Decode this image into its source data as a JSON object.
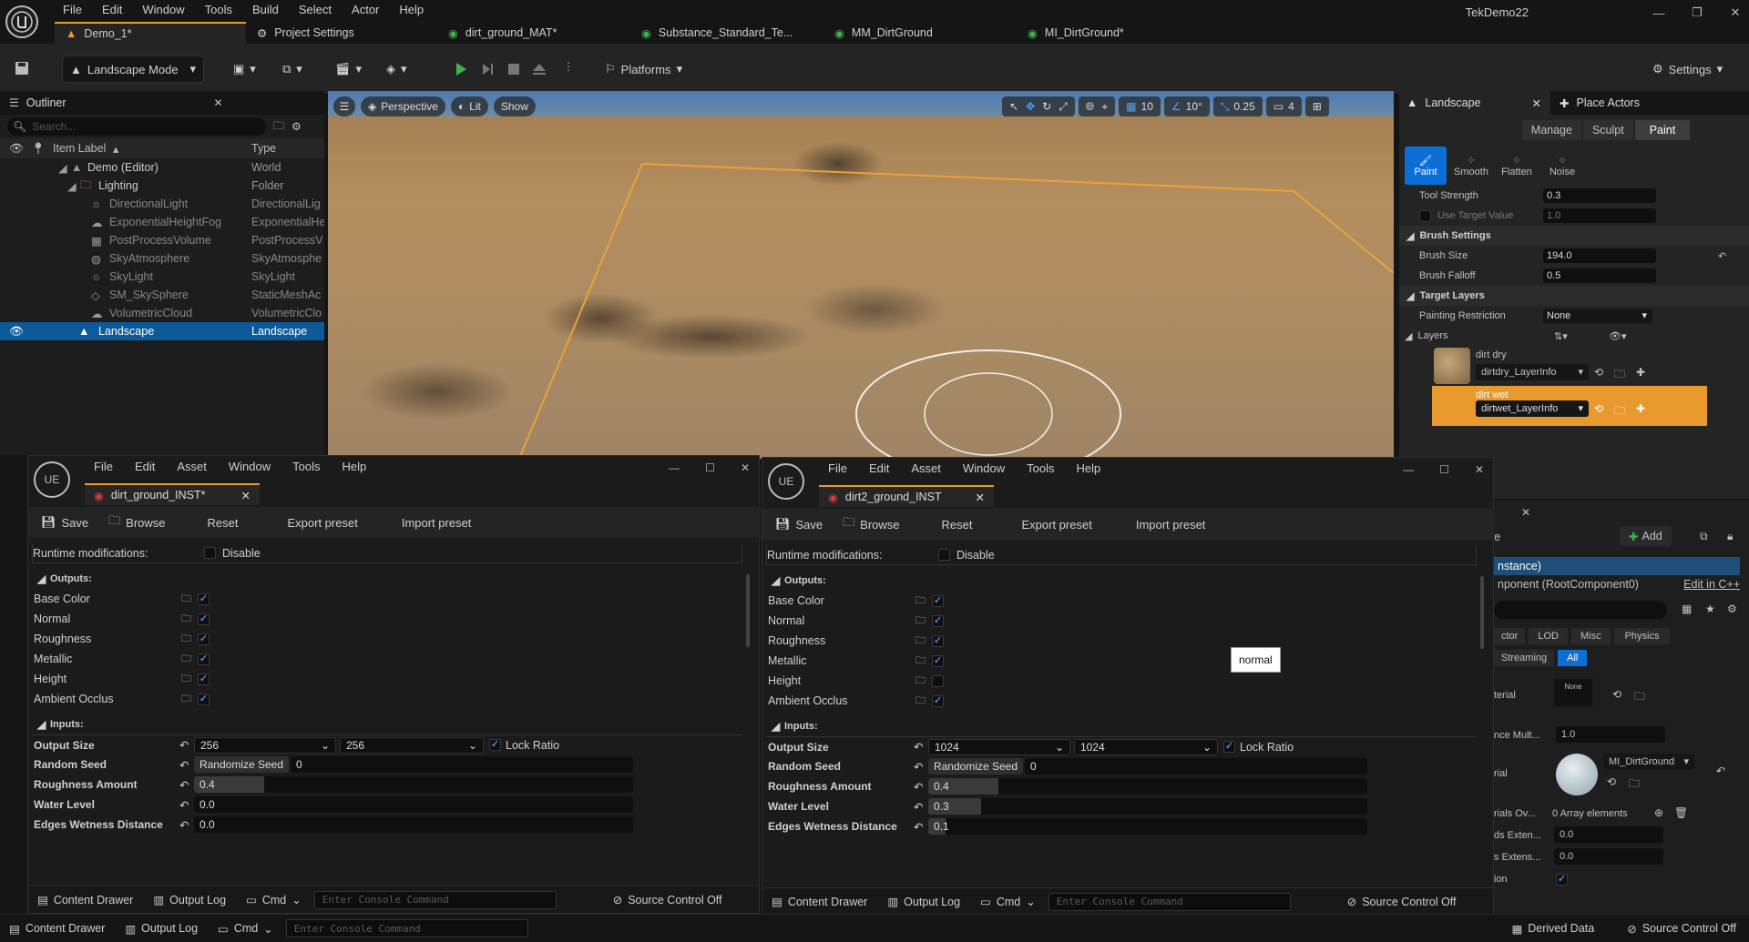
{
  "app": {
    "project_name": "TekDemo22",
    "menu": [
      "File",
      "Edit",
      "Window",
      "Tools",
      "Build",
      "Select",
      "Actor",
      "Help"
    ],
    "tabs": [
      {
        "label": "Demo_1*",
        "icon": "level-icon"
      },
      {
        "label": "Project Settings",
        "icon": "gear-icon"
      },
      {
        "label": "dirt_ground_MAT*",
        "icon": "substance-icon"
      },
      {
        "label": "Substance_Standard_Te...",
        "icon": "substance-icon"
      },
      {
        "label": "MM_DirtGround",
        "icon": "material-icon"
      },
      {
        "label": "MI_DirtGround*",
        "icon": "material-icon"
      }
    ]
  },
  "toolbar": {
    "mode_label": "Landscape Mode",
    "platforms_label": "Platforms",
    "settings_label": "Settings"
  },
  "outliner": {
    "tab_label": "Outliner",
    "search_placeholder": "Search...",
    "col_label": "Item Label",
    "col_type": "Type",
    "rows": [
      {
        "label": "Demo (Editor)",
        "type": "World",
        "indent": 0
      },
      {
        "label": "Lighting",
        "type": "Folder",
        "indent": 1
      },
      {
        "label": "DirectionalLight",
        "type": "DirectionalLig",
        "indent": 2
      },
      {
        "label": "ExponentialHeightFog",
        "type": "ExponentialHe",
        "indent": 2
      },
      {
        "label": "PostProcessVolume",
        "type": "PostProcessV",
        "indent": 2
      },
      {
        "label": "SkyAtmosphere",
        "type": "SkyAtmosphe",
        "indent": 2
      },
      {
        "label": "SkyLight",
        "type": "SkyLight",
        "indent": 2
      },
      {
        "label": "SM_SkySphere",
        "type": "StaticMeshAc",
        "indent": 2
      },
      {
        "label": "VolumetricCloud",
        "type": "VolumetricClo",
        "indent": 2
      },
      {
        "label": "Landscape",
        "type": "Landscape",
        "indent": 0
      }
    ]
  },
  "viewport": {
    "perspective": "Perspective",
    "lit": "Lit",
    "show": "Show",
    "grid_snap": "10",
    "rot_snap": "10°",
    "scale_snap": "0.25",
    "cam_speed": "4"
  },
  "landscape": {
    "tab_label": "Landscape",
    "place_tab_label": "Place Actors",
    "modes": [
      "Manage",
      "Sculpt",
      "Paint"
    ],
    "tools": [
      "Paint",
      "Smooth",
      "Flatten",
      "Noise"
    ],
    "tool_strength_label": "Tool Strength",
    "tool_strength": "0.3",
    "use_target_label": "Use Target Value",
    "use_target": "1.0",
    "brush_settings": "Brush Settings",
    "brush_size_label": "Brush Size",
    "brush_size": "194.0",
    "brush_falloff_label": "Brush Falloff",
    "brush_falloff": "0.5",
    "target_layers": "Target Layers",
    "painting_restriction_label": "Painting Restriction",
    "painting_restriction": "None",
    "layers_label": "Layers",
    "layer1_name": "dirt dry",
    "layer1_info": "dirtdry_LayerInfo",
    "layer2_name": "dirt wet",
    "layer2_info": "dirtwet_LayerInfo"
  },
  "details": {
    "add_label": "Add",
    "instance_label": "nstance)",
    "component_label": "nponent (RootComponent0)",
    "edit_cpp": "Edit in C++",
    "filters": [
      "ctor",
      "LOD",
      "Misc",
      "Physics"
    ],
    "filters2": [
      "Streaming",
      "All"
    ],
    "material_label": "terial",
    "material_none": "None",
    "tex_mult_label": "nce Mult...",
    "tex_mult": "1.0",
    "rial_label": "rial",
    "mi_name": "MI_DirtGround",
    "overrides_label": "rials Ov...",
    "overrides_value": "0 Array elements",
    "extent_label": "ds Exten...",
    "extent": "0.0",
    "extent2_label": "s Extens...",
    "extent2": "0.0",
    "ion_label": "ion"
  },
  "win1": {
    "menu": [
      "File",
      "Edit",
      "Asset",
      "Window",
      "Tools",
      "Help"
    ],
    "tab": "dirt_ground_INST*",
    "save": "Save",
    "browse": "Browse",
    "reset": "Reset",
    "export": "Export preset",
    "import": "Import preset",
    "runtime_label": "Runtime modifications:",
    "disable": "Disable",
    "outputs_label": "Outputs:",
    "outputs": [
      {
        "name": "Base Color",
        "on": true
      },
      {
        "name": "Normal",
        "on": true
      },
      {
        "name": "Roughness",
        "on": true
      },
      {
        "name": "Metallic",
        "on": true
      },
      {
        "name": "Height",
        "on": true
      },
      {
        "name": "Ambient Occlus",
        "on": true
      }
    ],
    "inputs_label": "Inputs:",
    "output_size_label": "Output Size",
    "size_w": "256",
    "size_h": "256",
    "lock_ratio": "Lock Ratio",
    "random_seed_label": "Random Seed",
    "randomize": "Randomize Seed",
    "seed": "0",
    "roughness_label": "Roughness Amount",
    "roughness": "0.4",
    "roughness_fill": 0.4,
    "water_label": "Water Level",
    "water": "0.0",
    "water_fill": 0.0,
    "edges_label": "Edges Wetness Distance",
    "edges": "0.0",
    "edges_fill": 0.0,
    "content_drawer": "Content Drawer",
    "output_log": "Output Log",
    "cmd": "Cmd",
    "console_placeholder": "Enter Console Command",
    "source_control": "Source Control Off"
  },
  "win2": {
    "menu": [
      "File",
      "Edit",
      "Asset",
      "Window",
      "Tools",
      "Help"
    ],
    "tab": "dirt2_ground_INST",
    "save": "Save",
    "browse": "Browse",
    "reset": "Reset",
    "export": "Export preset",
    "import": "Import preset",
    "runtime_label": "Runtime modifications:",
    "disable": "Disable",
    "outputs_label": "Outputs:",
    "outputs": [
      {
        "name": "Base Color",
        "on": true
      },
      {
        "name": "Normal",
        "on": true
      },
      {
        "name": "Roughness",
        "on": true
      },
      {
        "name": "Metallic",
        "on": true
      },
      {
        "name": "Height",
        "on": false
      },
      {
        "name": "Ambient Occlus",
        "on": true
      }
    ],
    "inputs_label": "Inputs:",
    "output_size_label": "Output Size",
    "size_w": "1024",
    "size_h": "1024",
    "lock_ratio": "Lock Ratio",
    "random_seed_label": "Random Seed",
    "randomize": "Randomize Seed",
    "seed": "0",
    "roughness_label": "Roughness Amount",
    "roughness": "0.4",
    "roughness_fill": 0.4,
    "water_label": "Water Level",
    "water": "0.3",
    "water_fill": 0.3,
    "edges_label": "Edges Wetness Distance",
    "edges": "0.1",
    "edges_fill": 0.1,
    "tooltip": "normal",
    "content_drawer": "Content Drawer",
    "output_log": "Output Log",
    "cmd": "Cmd",
    "console_placeholder": "Enter Console Command",
    "source_control": "Source Control Off"
  },
  "status": {
    "content_drawer": "Content Drawer",
    "output_log": "Output Log",
    "cmd": "Cmd",
    "console_placeholder": "Enter Console Command",
    "derived_data": "Derived Data",
    "source_control": "Source Control Off"
  },
  "colors": {
    "accent_orange": "#e89a2f",
    "selection_blue": "#0d5a9b",
    "play_green": "#3fb34f"
  }
}
